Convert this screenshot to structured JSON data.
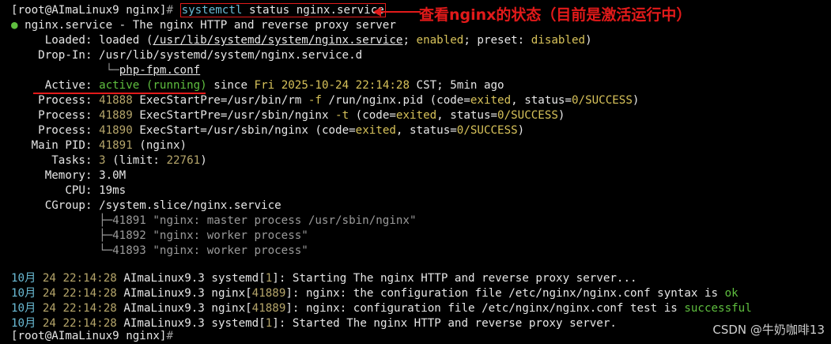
{
  "prompt1": {
    "user_host": "[root@AImaLinux9 nginx]",
    "symbol": "#"
  },
  "command": "systemctl status nginx.service",
  "annotation": "查看nginx的状态（目前是激活运行中）",
  "unit_line": {
    "bullet": "●",
    "text": " nginx.service - The nginx HTTP and reverse proxy server"
  },
  "loaded": {
    "label": "Loaded:",
    "pre": " loaded (",
    "path": "/usr/lib/systemd/system/nginx.service",
    "mid": "; ",
    "enabled": "enabled",
    "semi": "; preset: ",
    "preset": "disabled",
    "end": ")"
  },
  "dropin": {
    "label": "Drop-In:",
    "path": " /usr/lib/systemd/system/nginx.service.d",
    "tree": "└─",
    "file": "php-fpm.conf"
  },
  "active": {
    "label": "Active:",
    "state": "active (running)",
    "since": " since ",
    "date": "Fri 2025-10-24 22:14:28",
    "tail": " CST; 5min ago"
  },
  "processes": [
    {
      "label": "Process:",
      "pid": "41888",
      "cmd": " ExecStartPre=/usr/bin/rm ",
      "flag": "-f",
      "args": " /run/nginx.pid (code=",
      "code": "exited",
      "st": ", status=",
      "status": "0/SUCCESS",
      "end": ")"
    },
    {
      "label": "Process:",
      "pid": "41889",
      "cmd": " ExecStartPre=/usr/sbin/nginx ",
      "flag": "-t",
      "args": " (code=",
      "code": "exited",
      "st": ", status=",
      "status": "0/SUCCESS",
      "end": ")"
    },
    {
      "label": "Process:",
      "pid": "41890",
      "cmd": " ExecStart=/usr/sbin/nginx (code=",
      "flag": "",
      "args": "",
      "code": "exited",
      "st": ", status=",
      "status": "0/SUCCESS",
      "end": ")"
    }
  ],
  "mainpid": {
    "label": "Main PID:",
    "pid": "41891",
    "name": " (nginx)"
  },
  "tasks": {
    "label": "Tasks:",
    "count": "3",
    "pre": " (limit: ",
    "limit": "22761",
    "end": ")"
  },
  "memory": {
    "label": "Memory:",
    "value": "3.0M"
  },
  "cpu": {
    "label": "CPU:",
    "value": "19ms"
  },
  "cgroup": {
    "label": "CGroup:",
    "value": "/system.slice/nginx.service"
  },
  "cgroup_children": [
    {
      "tree": "├─",
      "text": "41891 \"nginx: master process /usr/sbin/nginx\""
    },
    {
      "tree": "├─",
      "text": "41892 \"nginx: worker process\""
    },
    {
      "tree": "└─",
      "text": "41893 \"nginx: worker process\""
    }
  ],
  "logs": [
    {
      "month": "10月",
      "day": "24",
      "time": "22:14:28",
      "host": " AImaLinux9.3 ",
      "proc": "systemd[",
      "pid": "1",
      "close": "]: ",
      "msg": "Starting The nginx HTTP and reverse proxy server...",
      "hl": ""
    },
    {
      "month": "10月",
      "day": "24",
      "time": "22:14:28",
      "host": " AImaLinux9.3 ",
      "proc": "nginx[",
      "pid": "41889",
      "close": "]: ",
      "msg": "nginx: the configuration file /etc/nginx/nginx.conf syntax is ",
      "hl": "ok"
    },
    {
      "month": "10月",
      "day": "24",
      "time": "22:14:28",
      "host": " AImaLinux9.3 ",
      "proc": "nginx[",
      "pid": "41889",
      "close": "]: ",
      "msg": "nginx: configuration file /etc/nginx/nginx.conf test is ",
      "hl": "successful"
    },
    {
      "month": "10月",
      "day": "24",
      "time": "22:14:28",
      "host": " AImaLinux9.3 ",
      "proc": "systemd[",
      "pid": "1",
      "close": "]: ",
      "msg": "Started The nginx HTTP and reverse proxy server.",
      "hl": ""
    }
  ],
  "prompt2": {
    "user_host": "[root@AImaLinux9 nginx]",
    "symbol": "#"
  },
  "watermark": "CSDN @牛奶咖啡13"
}
